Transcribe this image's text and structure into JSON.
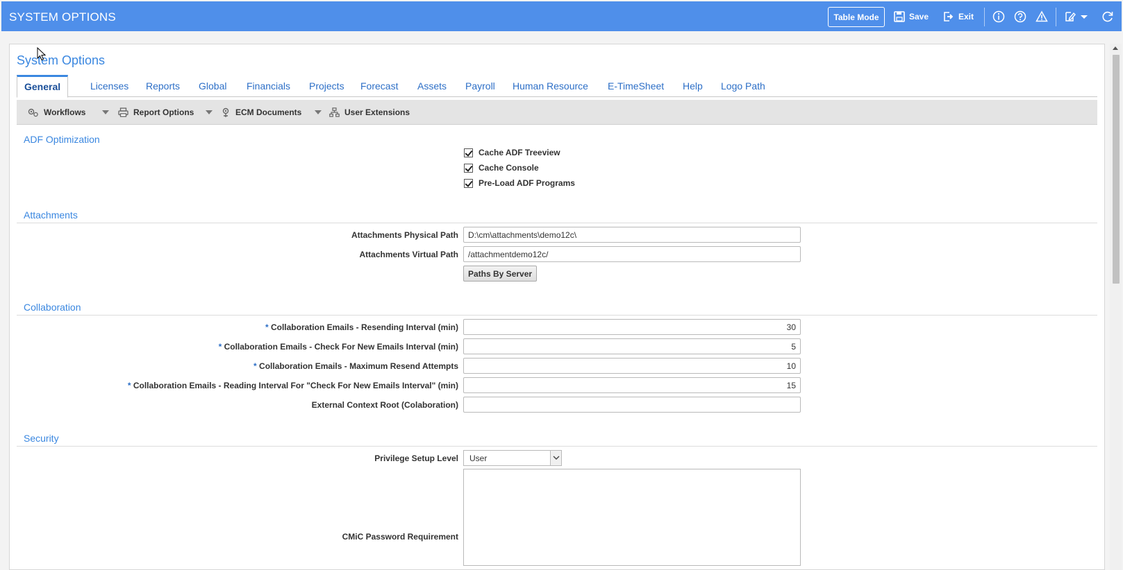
{
  "header": {
    "title": "SYSTEM OPTIONS",
    "table_mode": "Table Mode",
    "save": "Save",
    "exit": "Exit"
  },
  "page": {
    "title": "System Options"
  },
  "tabs": [
    {
      "label": "General",
      "active": true
    },
    {
      "label": "Licenses"
    },
    {
      "label": "Reports"
    },
    {
      "label": "Global"
    },
    {
      "label": "Financials"
    },
    {
      "label": "Projects"
    },
    {
      "label": "Forecast"
    },
    {
      "label": "Assets"
    },
    {
      "label": "Payroll"
    },
    {
      "label": "Human Resource"
    },
    {
      "label": "E-TimeSheet"
    },
    {
      "label": "Help"
    },
    {
      "label": "Logo Path"
    }
  ],
  "subtoolbar": {
    "workflows": "Workflows",
    "report_options": "Report Options",
    "ecm_documents": "ECM Documents",
    "user_extensions": "User Extensions"
  },
  "adf": {
    "title": "ADF Optimization",
    "checkboxes": [
      {
        "label": "Cache ADF Treeview",
        "checked": true
      },
      {
        "label": "Cache Console",
        "checked": true
      },
      {
        "label": "Pre-Load ADF Programs",
        "checked": true
      }
    ]
  },
  "attachments": {
    "title": "Attachments",
    "physical_path_label": "Attachments Physical Path",
    "physical_path_value": "D:\\cm\\attachments\\demo12c\\",
    "virtual_path_label": "Attachments Virtual Path",
    "virtual_path_value": "/attachmentdemo12c/",
    "paths_by_server": "Paths By Server"
  },
  "collaboration": {
    "title": "Collaboration",
    "required_mark": "*",
    "resend_interval_label": "Collaboration Emails - Resending Interval (min)",
    "resend_interval_value": "30",
    "check_interval_label": "Collaboration Emails - Check For New Emails Interval (min)",
    "check_interval_value": "5",
    "max_resend_label": "Collaboration Emails - Maximum Resend Attempts",
    "max_resend_value": "10",
    "reading_interval_label": "Collaboration Emails - Reading Interval For \"Check For New Emails Interval\" (min)",
    "reading_interval_value": "15",
    "context_root_label": "External Context Root (Colaboration)",
    "context_root_value": ""
  },
  "security": {
    "title": "Security",
    "privilege_label": "Privilege Setup Level",
    "privilege_value": "User",
    "password_label": "CMiC Password Requirement"
  }
}
